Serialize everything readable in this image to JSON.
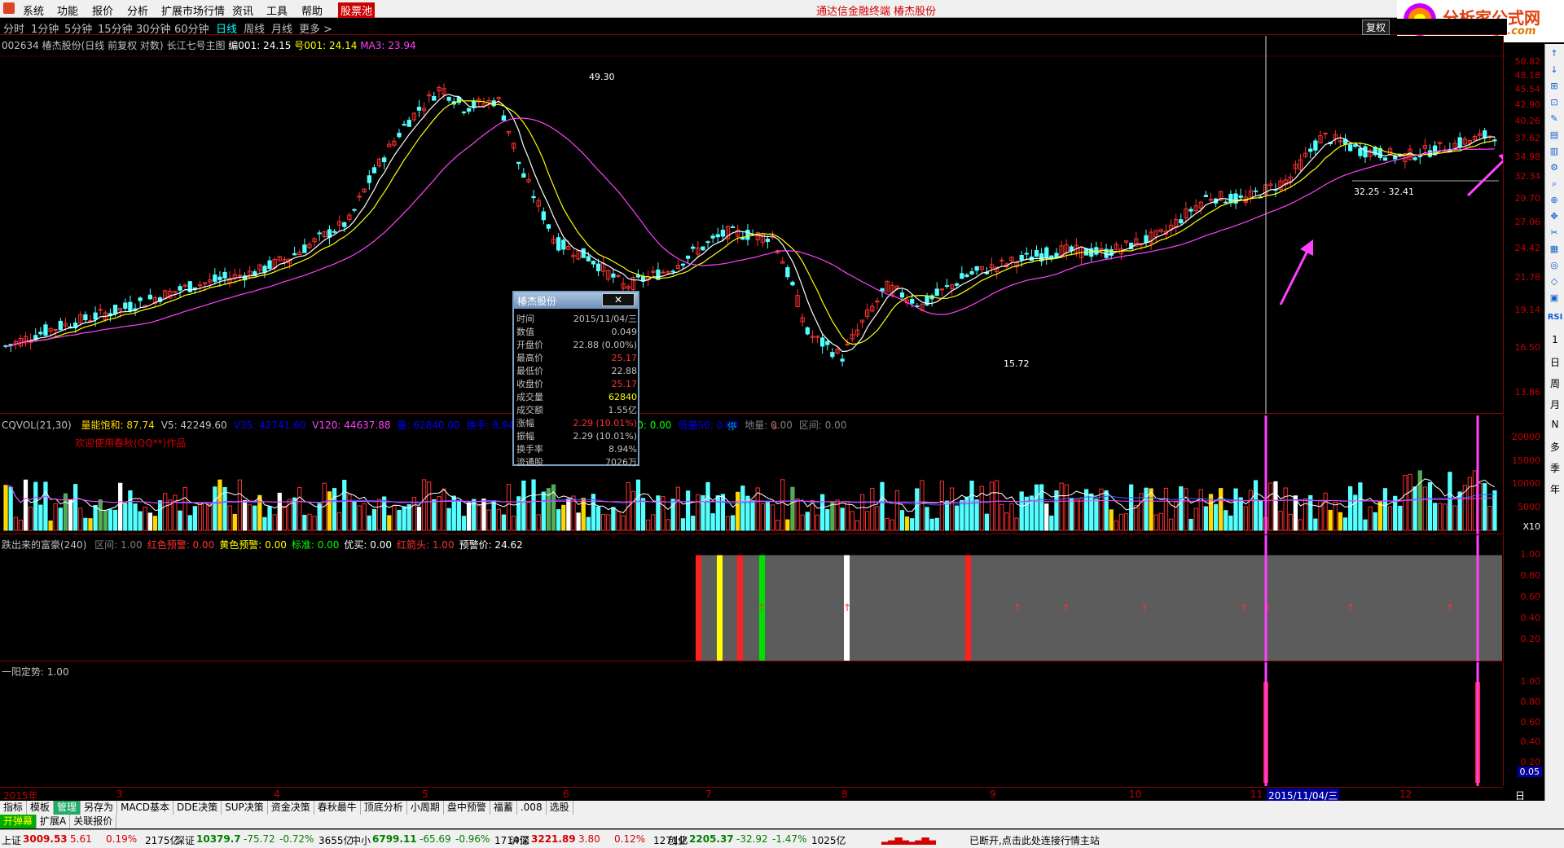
{
  "menu": {
    "items": [
      "系统",
      "功能",
      "报价",
      "分析",
      "扩展市场行情",
      "资讯",
      "工具",
      "帮助"
    ],
    "stock_pool": "股票池",
    "center_title": "通达信金融终端    椿杰股份"
  },
  "logo": {
    "name": "分析家公式网",
    "url": "www.88gs.com"
  },
  "periods": {
    "items": [
      "分时",
      "1分钟",
      "5分钟",
      "15分钟",
      "30分钟",
      "60分钟",
      "日线",
      "周线",
      "月线",
      "更多 >"
    ],
    "active": "日线",
    "fq": "复权"
  },
  "info": {
    "code_name": "002634 椿杰股份(日线 前复权 对数)",
    "indicator": "长江七号主图",
    "bian_label": "编001: 24.15",
    "hao_label": "号001: 24.14",
    "ma3_label": "MA3: 23.94"
  },
  "price_axis": [
    "50.82",
    "48.18",
    "45.54",
    "42.90",
    "40.26",
    "37.62",
    "34.98",
    "32.34",
    "29.70",
    "27.06",
    "24.42",
    "21.78",
    "19.14",
    "16.50",
    "13.86"
  ],
  "price_annotations": {
    "high": "49.30",
    "low": "15.72",
    "range": "32.25 - 32.41"
  },
  "volume_pane": {
    "title": "CQVOL(21,30)",
    "fields": [
      {
        "label": "量能饱和: 87.74",
        "color": "#ffd700"
      },
      {
        "label": "V5: 42249.60",
        "color": "#c0c0c0"
      },
      {
        "label": "V35: 42741.60",
        "color": "#0000ff"
      },
      {
        "label": "V120: 44637.88",
        "color": "#ff40ff"
      },
      {
        "label": "量: 62840.00",
        "color": "#0000ff"
      },
      {
        "label": "换手: 8.94",
        "color": "#0000ff"
      },
      {
        "label": "换10T: 6",
        "color": "#c0c0c0"
      },
      {
        "label": "量: 0.00",
        "color": "#c0c0c0"
      },
      {
        "label": "低量10: 0.00",
        "color": "#00ff00"
      },
      {
        "label": "低量50: 0.00",
        "color": "#0000ff"
      },
      {
        "label": "地量: 0.00",
        "color": "#808080"
      },
      {
        "label": "区间: 0.00",
        "color": "#808080"
      }
    ],
    "welcome": "欢迎使用春秋(QQ**)作品",
    "axis": [
      "20000",
      "15000",
      "10000",
      "5000"
    ],
    "unit": "X10",
    "markers": [
      "停",
      "S"
    ]
  },
  "rich_pane": {
    "title": "跌出来的富豪(240)",
    "fields": [
      {
        "label": "区间: 1.00",
        "color": "#808080"
      },
      {
        "label": "红色预警: 0.00",
        "color": "#ff3030"
      },
      {
        "label": "黄色预警: 0.00",
        "color": "#ffff00"
      },
      {
        "label": "标准: 0.00",
        "color": "#00ff00"
      },
      {
        "label": "优买: 0.00",
        "color": "#ffffff"
      },
      {
        "label": "红箭头: 1.00",
        "color": "#ff3030"
      },
      {
        "label": "预警价: 24.62",
        "color": "#ffffff"
      }
    ],
    "axis": [
      "1.00",
      "0.80",
      "0.60",
      "0.40",
      "0.20"
    ]
  },
  "yang_pane": {
    "title": "一阳定势: 1.00",
    "axis": [
      "1.00",
      "0.80",
      "0.60",
      "0.40",
      "0.20"
    ],
    "cursor_value": "0.05"
  },
  "x_axis": {
    "labels": [
      "2015年",
      "3",
      "4",
      "5",
      "6",
      "7",
      "8",
      "9",
      "10",
      "11",
      "12"
    ],
    "selected": "2015/11/04/三",
    "period": "日线"
  },
  "popup": {
    "title": "椿杰股份",
    "close": "✕",
    "rows": [
      {
        "k": "时间",
        "v": "2015/11/04/三",
        "c": "#c0c0c0"
      },
      {
        "k": "数值",
        "v": "0.049",
        "c": "#c0c0c0"
      },
      {
        "k": "开盘价",
        "v": "22.88 (0.00%)",
        "c": "#c0c0c0"
      },
      {
        "k": "最高价",
        "v": "25.17",
        "c": "#ff3030"
      },
      {
        "k": "最低价",
        "v": "22.88",
        "c": "#c0c0c0"
      },
      {
        "k": "收盘价",
        "v": "25.17",
        "c": "#ff3030"
      },
      {
        "k": "成交量",
        "v": "62840",
        "c": "#ffff00"
      },
      {
        "k": "成交额",
        "v": "1.55亿",
        "c": "#c0c0c0"
      },
      {
        "k": "涨幅",
        "v": "2.29 (10.01%)",
        "c": "#ff3030"
      },
      {
        "k": "振幅",
        "v": "2.29 (10.01%)",
        "c": "#c0c0c0"
      },
      {
        "k": "换手率",
        "v": "8.94%",
        "c": "#c0c0c0"
      },
      {
        "k": "流通股",
        "v": "7026万",
        "c": "#c0c0c0"
      }
    ]
  },
  "tabs1": [
    "指标",
    "模板",
    "管理",
    "另存为",
    "MACD基本",
    "DDE决策",
    "SUP决策",
    "资金决策",
    "春秋最牛",
    "顶底分析",
    "小周期",
    "盘中预警",
    "福蓄",
    ".008",
    "选股"
  ],
  "tabs1_active": "管理",
  "tabs2": [
    "开弹幕",
    "扩展A",
    "关联报价"
  ],
  "right_toolbar": {
    "labels": [
      "RSI",
      "1",
      "日",
      "周",
      "月",
      "N",
      "多",
      "季",
      "年"
    ]
  },
  "status": {
    "sh": {
      "name": "上证",
      "price": "3009.53",
      "chg": "5.61",
      "pct": "0.19%",
      "amt": "2175亿"
    },
    "sz": {
      "name": "深证",
      "price": "10379.7",
      "chg": "-75.72",
      "pct": "-0.72%",
      "amt": "3655亿"
    },
    "zx": {
      "name": "中小",
      "price": "6799.11",
      "chg": "-65.69",
      "pct": "-0.96%",
      "amt": "1714亿"
    },
    "hs": {
      "name": "沪深",
      "price": "3221.89",
      "chg": "3.80",
      "pct": "0.12%",
      "amt": "1271亿"
    },
    "cy": {
      "name": "创业",
      "price": "2205.37",
      "chg": "-32.92",
      "pct": "-1.47%",
      "amt": "1025亿"
    },
    "message": "已断开,点击此处连接行情主站"
  },
  "colors": {
    "up": "#ff3030",
    "down": "#54ffff",
    "ma1": "#ffffff",
    "ma2": "#ffff00",
    "ma3": "#ff40ff",
    "arrow": "#ff40ff"
  }
}
